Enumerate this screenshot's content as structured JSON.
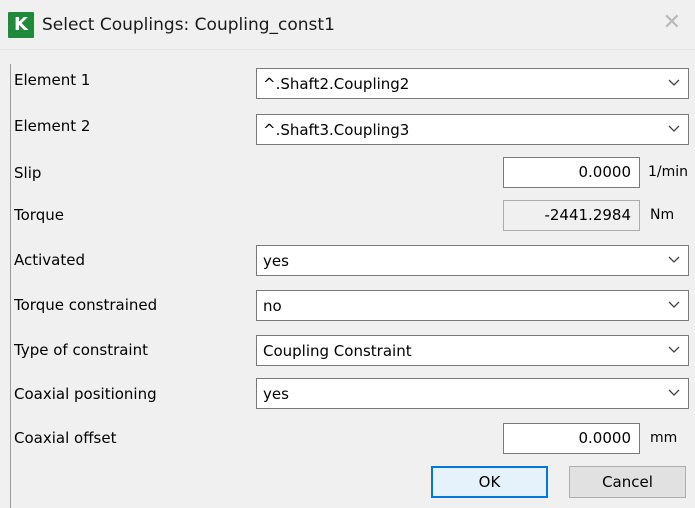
{
  "window": {
    "title": "Select Couplings: Coupling_const1",
    "app_icon_letter": "K",
    "close_glyph": "✕"
  },
  "fields": {
    "element1": {
      "label": "Element 1",
      "value": "^.Shaft2.Coupling2"
    },
    "element2": {
      "label": "Element 2",
      "value": "^.Shaft3.Coupling3"
    },
    "slip": {
      "label": "Slip",
      "value": "0.0000",
      "unit": "1/min"
    },
    "torque": {
      "label": "Torque",
      "value": "-2441.2984",
      "unit": "Nm"
    },
    "activated": {
      "label": "Activated",
      "value": "yes"
    },
    "torque_constrained": {
      "label": "Torque constrained",
      "value": "no"
    },
    "constraint_type": {
      "label": "Type of constraint",
      "value": "Coupling Constraint"
    },
    "coaxial_positioning": {
      "label": "Coaxial positioning",
      "value": "yes"
    },
    "coaxial_offset": {
      "label": "Coaxial offset",
      "value": "0.0000",
      "unit": "mm"
    }
  },
  "buttons": {
    "ok": "OK",
    "cancel": "Cancel"
  },
  "colors": {
    "icon_bg": "#1f8a3c",
    "ok_border": "#0078d7"
  },
  "icons": {
    "dropdown": "chevron-down-icon",
    "close": "close-icon",
    "app": "app-icon"
  }
}
